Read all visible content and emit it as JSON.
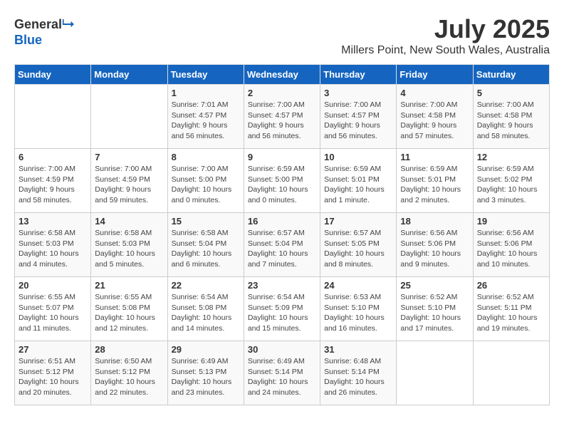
{
  "header": {
    "logo_general": "General",
    "logo_blue": "Blue",
    "month_year": "July 2025",
    "location": "Millers Point, New South Wales, Australia"
  },
  "weekdays": [
    "Sunday",
    "Monday",
    "Tuesday",
    "Wednesday",
    "Thursday",
    "Friday",
    "Saturday"
  ],
  "weeks": [
    [
      {
        "day": "",
        "info": ""
      },
      {
        "day": "",
        "info": ""
      },
      {
        "day": "1",
        "info": "Sunrise: 7:01 AM\nSunset: 4:57 PM\nDaylight: 9 hours and 56 minutes."
      },
      {
        "day": "2",
        "info": "Sunrise: 7:00 AM\nSunset: 4:57 PM\nDaylight: 9 hours and 56 minutes."
      },
      {
        "day": "3",
        "info": "Sunrise: 7:00 AM\nSunset: 4:57 PM\nDaylight: 9 hours and 56 minutes."
      },
      {
        "day": "4",
        "info": "Sunrise: 7:00 AM\nSunset: 4:58 PM\nDaylight: 9 hours and 57 minutes."
      },
      {
        "day": "5",
        "info": "Sunrise: 7:00 AM\nSunset: 4:58 PM\nDaylight: 9 hours and 58 minutes."
      }
    ],
    [
      {
        "day": "6",
        "info": "Sunrise: 7:00 AM\nSunset: 4:59 PM\nDaylight: 9 hours and 58 minutes."
      },
      {
        "day": "7",
        "info": "Sunrise: 7:00 AM\nSunset: 4:59 PM\nDaylight: 9 hours and 59 minutes."
      },
      {
        "day": "8",
        "info": "Sunrise: 7:00 AM\nSunset: 5:00 PM\nDaylight: 10 hours and 0 minutes."
      },
      {
        "day": "9",
        "info": "Sunrise: 6:59 AM\nSunset: 5:00 PM\nDaylight: 10 hours and 0 minutes."
      },
      {
        "day": "10",
        "info": "Sunrise: 6:59 AM\nSunset: 5:01 PM\nDaylight: 10 hours and 1 minute."
      },
      {
        "day": "11",
        "info": "Sunrise: 6:59 AM\nSunset: 5:01 PM\nDaylight: 10 hours and 2 minutes."
      },
      {
        "day": "12",
        "info": "Sunrise: 6:59 AM\nSunset: 5:02 PM\nDaylight: 10 hours and 3 minutes."
      }
    ],
    [
      {
        "day": "13",
        "info": "Sunrise: 6:58 AM\nSunset: 5:03 PM\nDaylight: 10 hours and 4 minutes."
      },
      {
        "day": "14",
        "info": "Sunrise: 6:58 AM\nSunset: 5:03 PM\nDaylight: 10 hours and 5 minutes."
      },
      {
        "day": "15",
        "info": "Sunrise: 6:58 AM\nSunset: 5:04 PM\nDaylight: 10 hours and 6 minutes."
      },
      {
        "day": "16",
        "info": "Sunrise: 6:57 AM\nSunset: 5:04 PM\nDaylight: 10 hours and 7 minutes."
      },
      {
        "day": "17",
        "info": "Sunrise: 6:57 AM\nSunset: 5:05 PM\nDaylight: 10 hours and 8 minutes."
      },
      {
        "day": "18",
        "info": "Sunrise: 6:56 AM\nSunset: 5:06 PM\nDaylight: 10 hours and 9 minutes."
      },
      {
        "day": "19",
        "info": "Sunrise: 6:56 AM\nSunset: 5:06 PM\nDaylight: 10 hours and 10 minutes."
      }
    ],
    [
      {
        "day": "20",
        "info": "Sunrise: 6:55 AM\nSunset: 5:07 PM\nDaylight: 10 hours and 11 minutes."
      },
      {
        "day": "21",
        "info": "Sunrise: 6:55 AM\nSunset: 5:08 PM\nDaylight: 10 hours and 12 minutes."
      },
      {
        "day": "22",
        "info": "Sunrise: 6:54 AM\nSunset: 5:08 PM\nDaylight: 10 hours and 14 minutes."
      },
      {
        "day": "23",
        "info": "Sunrise: 6:54 AM\nSunset: 5:09 PM\nDaylight: 10 hours and 15 minutes."
      },
      {
        "day": "24",
        "info": "Sunrise: 6:53 AM\nSunset: 5:10 PM\nDaylight: 10 hours and 16 minutes."
      },
      {
        "day": "25",
        "info": "Sunrise: 6:52 AM\nSunset: 5:10 PM\nDaylight: 10 hours and 17 minutes."
      },
      {
        "day": "26",
        "info": "Sunrise: 6:52 AM\nSunset: 5:11 PM\nDaylight: 10 hours and 19 minutes."
      }
    ],
    [
      {
        "day": "27",
        "info": "Sunrise: 6:51 AM\nSunset: 5:12 PM\nDaylight: 10 hours and 20 minutes."
      },
      {
        "day": "28",
        "info": "Sunrise: 6:50 AM\nSunset: 5:12 PM\nDaylight: 10 hours and 22 minutes."
      },
      {
        "day": "29",
        "info": "Sunrise: 6:49 AM\nSunset: 5:13 PM\nDaylight: 10 hours and 23 minutes."
      },
      {
        "day": "30",
        "info": "Sunrise: 6:49 AM\nSunset: 5:14 PM\nDaylight: 10 hours and 24 minutes."
      },
      {
        "day": "31",
        "info": "Sunrise: 6:48 AM\nSunset: 5:14 PM\nDaylight: 10 hours and 26 minutes."
      },
      {
        "day": "",
        "info": ""
      },
      {
        "day": "",
        "info": ""
      }
    ]
  ]
}
